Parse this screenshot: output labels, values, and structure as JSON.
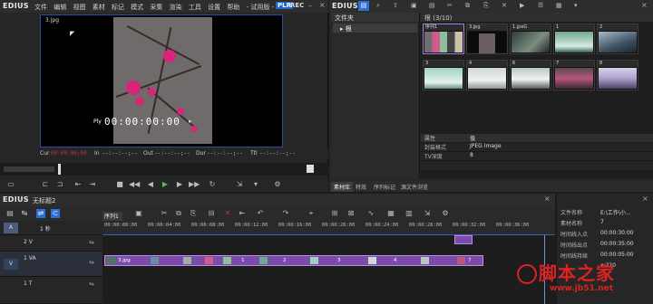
{
  "app": {
    "name": "EDIUS",
    "trial": "- 试用版 -",
    "plr": "PLR",
    "rec": "REC"
  },
  "menu": [
    "文件",
    "编辑",
    "视图",
    "素材",
    "标记",
    "模式",
    "采集",
    "渲染",
    "工具",
    "设置",
    "帮助"
  ],
  "player": {
    "file_label": "3.jpg",
    "play_label": "Ply",
    "timecode": "00:00:00:00",
    "cur_label": "Cur",
    "cur_value": "00:00:00;00",
    "in_label": "In",
    "in_value": "--:--:--;--",
    "out_label": "Out",
    "out_value": "--:--:--;--",
    "dur_label": "Dur",
    "dur_value": "--:--:--;--",
    "ttl_label": "Ttl",
    "ttl_value": "--:--:--;--"
  },
  "bin": {
    "title": "EDIUS",
    "folder_header": "文件夹",
    "root_folder": "根",
    "path": "根 (3/10)",
    "clips": [
      {
        "label": "序列1"
      },
      {
        "label": "3.jpg"
      },
      {
        "label": "1.jpeG"
      },
      {
        "label": "1"
      },
      {
        "label": "2"
      },
      {
        "label": "3"
      },
      {
        "label": "4"
      },
      {
        "label": "6"
      },
      {
        "label": "7"
      },
      {
        "label": "8"
      }
    ],
    "props_header": {
      "key": "属性",
      "value": "值"
    },
    "props": [
      {
        "key": "封装格式",
        "value": "JPEG Image"
      },
      {
        "key": "TV深度",
        "value": "8"
      }
    ],
    "tabs": [
      "素材库",
      "特效",
      "序列标记",
      "源文件浏览"
    ]
  },
  "timeline": {
    "title": "EDIUS",
    "project": "无标题2",
    "sequence_tab": "序列1",
    "zoom": "1 秒",
    "ruler": [
      "00:00:00:00",
      "00:00:04:00",
      "00:00:08:00",
      "00:00:12:00",
      "00:00:16:00",
      "00:00:20:00",
      "00:00:24:00",
      "00:00:28:00",
      "00:00:32:00",
      "00:00:36:00"
    ],
    "tracks": [
      {
        "box": "A",
        "label": ""
      },
      {
        "box": "",
        "label": "2 V"
      },
      {
        "box": "V",
        "label": "1 VA"
      },
      {
        "box": "",
        "label": "1 T"
      }
    ],
    "clips": [
      "3.jpg",
      "1",
      "2",
      "3",
      "4",
      "7"
    ]
  },
  "info": {
    "rows": [
      {
        "key": "文件名称",
        "value": "E:\\工作\\小..."
      },
      {
        "key": "素材名称",
        "value": "7"
      },
      {
        "key": "时间线入点",
        "value": "00:00:30:00"
      },
      {
        "key": "时间线出点",
        "value": "00:00:35:00"
      },
      {
        "key": "时间线持续",
        "value": "00:00:05:00"
      },
      {
        "key": "",
        "value": "x 220"
      }
    ]
  },
  "watermark": {
    "cn": "脚本之家",
    "url": "www.jb51.net"
  },
  "colors": {
    "accent": "#2c6fd6",
    "clip": "#7a4ea8",
    "watermark": "#dd2222"
  }
}
